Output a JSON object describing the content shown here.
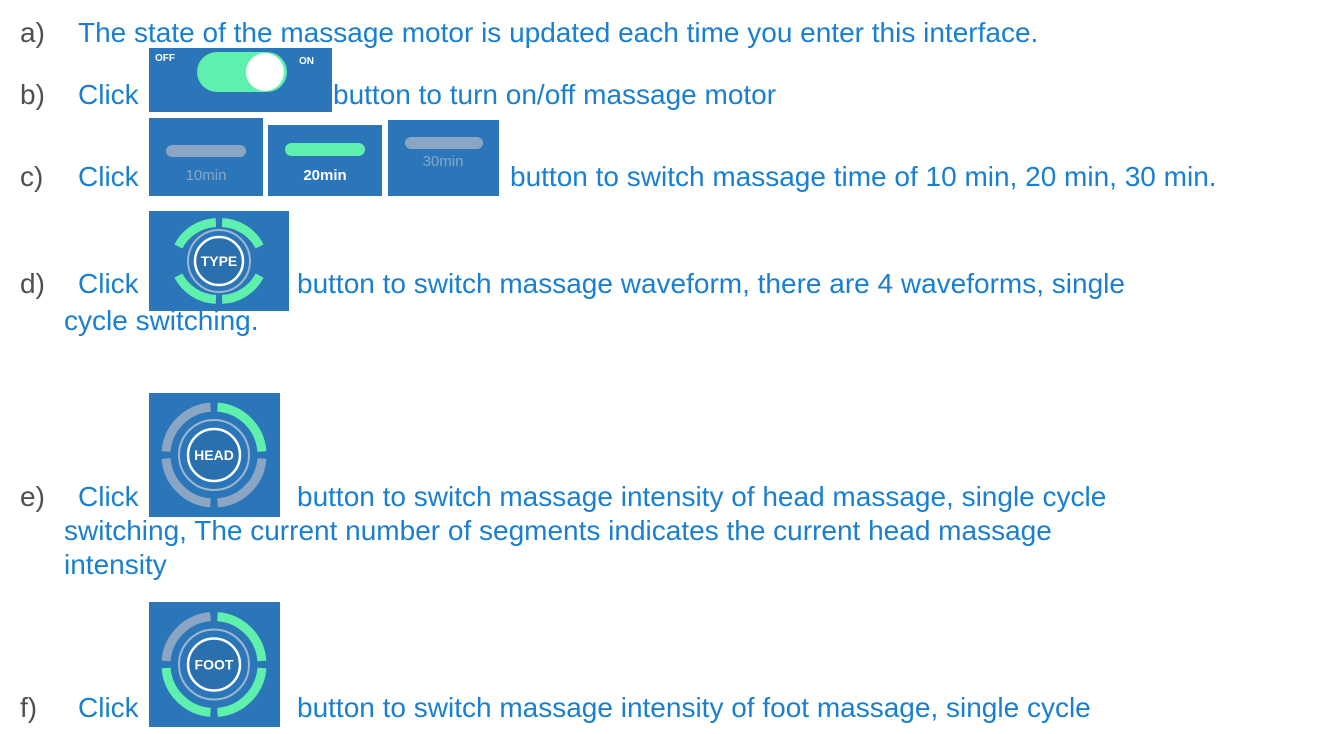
{
  "items": {
    "a": {
      "marker": "a)",
      "text": "The state of the massage motor is updated each time you enter this interface."
    },
    "b": {
      "marker": "b)",
      "click": "Click",
      "text": "button to turn on/off massage motor"
    },
    "c": {
      "marker": "c)",
      "click": "Click",
      "text": "button to switch massage time of 10 min, 20 min, 30 min."
    },
    "d": {
      "marker": "d)",
      "click": "Click",
      "text_line1": "button  to  switch  massage  waveform,  there  are  4  waveforms,  single",
      "text_line2": "cycle switching."
    },
    "e": {
      "marker": "e)",
      "click": "Click",
      "text_line1": "button  to  switch  massage  intensity  of  head  massage,  single  cycle",
      "text_line2": "switching,  The  current  number  of  segments  indicates  the  current  head  massage",
      "text_line3": "intensity"
    },
    "f": {
      "marker": "f)",
      "click": "Click",
      "text_line1": "button  to  switch  massage  intensity  of  foot  massage,  single  cycle"
    }
  },
  "toggle": {
    "off_label": "OFF",
    "on_label": "ON",
    "state": "on"
  },
  "time_buttons": [
    {
      "label": "10min",
      "selected": false
    },
    {
      "label": "20min",
      "selected": true
    },
    {
      "label": "30min",
      "selected": false
    }
  ],
  "ring_buttons": {
    "type": {
      "label": "TYPE"
    },
    "head": {
      "label": "HEAD"
    },
    "foot": {
      "label": "FOOT"
    }
  },
  "colors": {
    "text": "#1a7fd1",
    "marker": "#4f4f4f",
    "tile_bg": "#2b76b9",
    "active_green": "#5ff0ad",
    "inactive_gray": "#8aa6c4"
  }
}
